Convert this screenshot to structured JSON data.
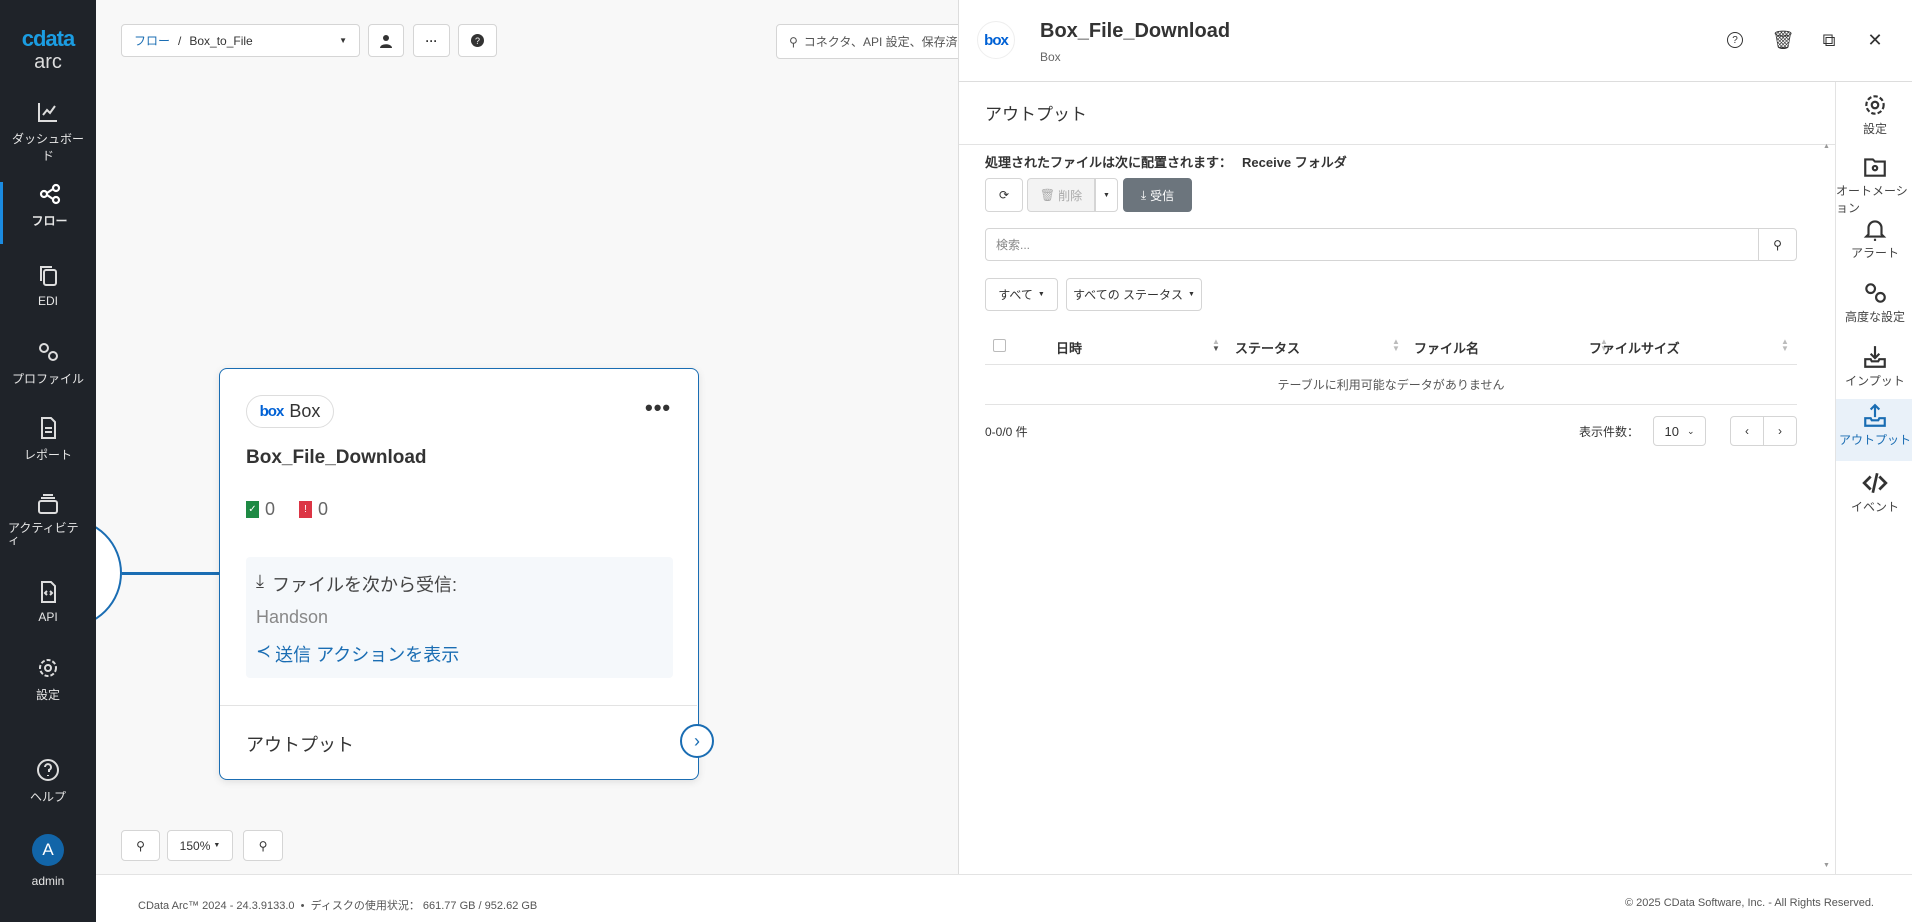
{
  "brand": {
    "logo_top": "cdata",
    "logo_bottom": "arc",
    "accent": "#1b8be0"
  },
  "sidebar": {
    "items": [
      {
        "label": "ダッシュボード",
        "icon": "chart-line-icon"
      },
      {
        "label": "フロー",
        "icon": "flow-icon",
        "active": true
      },
      {
        "label": "EDI",
        "icon": "copy-icon"
      },
      {
        "label": "プロファイル",
        "icon": "gears-icon"
      },
      {
        "label": "レポート",
        "icon": "file-text-icon"
      },
      {
        "label": "アクティビティ",
        "icon": "layers-icon"
      },
      {
        "label": "API",
        "icon": "file-code-icon"
      },
      {
        "label": "設定",
        "icon": "gear-icon"
      },
      {
        "label": "ヘルプ",
        "icon": "help-icon"
      }
    ],
    "user": {
      "initial": "A",
      "name": "admin"
    }
  },
  "toolbar": {
    "breadcrumb_root": "フロー",
    "breadcrumb_sep": "/",
    "flow_name": "Box_to_File",
    "search_placeholder": "コネクタ、API 設定、保存済み"
  },
  "card": {
    "connector": "Box",
    "title": "Box_File_Download",
    "success_count": "0",
    "error_count": "0",
    "receive_label": "ファイルを次から受信:",
    "receive_value": "Handson",
    "send_link": "送信 アクションを表示",
    "footer_label": "アウトプット"
  },
  "zoom": {
    "level": "150%"
  },
  "panel": {
    "title": "Box_File_Download",
    "subtitle": "Box",
    "section_title": "アウトプット",
    "info_label": "処理されたファイルは次に配置されます：",
    "info_value": "Receive フォルダ",
    "delete_label": "削除",
    "receive_label": "受信",
    "search_placeholder": "検索...",
    "filter_all": "すべて",
    "filter_status": "すべての ステータス",
    "columns": [
      "日時",
      "ステータス",
      "ファイル名",
      "ファイルサイズ"
    ],
    "empty_message": "テーブルに利用可能なデータがありません",
    "range": "0-0/0 件",
    "page_size_label": "表示件数：",
    "page_size": "10",
    "rail": [
      {
        "label": "設定",
        "icon": "gear-icon"
      },
      {
        "label": "オートメーション",
        "icon": "folder-gear-icon"
      },
      {
        "label": "アラート",
        "icon": "bell-icon"
      },
      {
        "label": "高度な設定",
        "icon": "gears-icon"
      },
      {
        "label": "インプット",
        "icon": "inbox-in-icon"
      },
      {
        "label": "アウトプット",
        "icon": "inbox-out-icon",
        "active": true
      },
      {
        "label": "イベント",
        "icon": "code-icon"
      }
    ]
  },
  "footer": {
    "version": "CData Arc™ 2024 - 24.3.9133.0  •  ディスクの使用状況： 661.77 GB / 952.62 GB",
    "copyright": "© 2025 CData Software, Inc. - All Rights Reserved."
  }
}
